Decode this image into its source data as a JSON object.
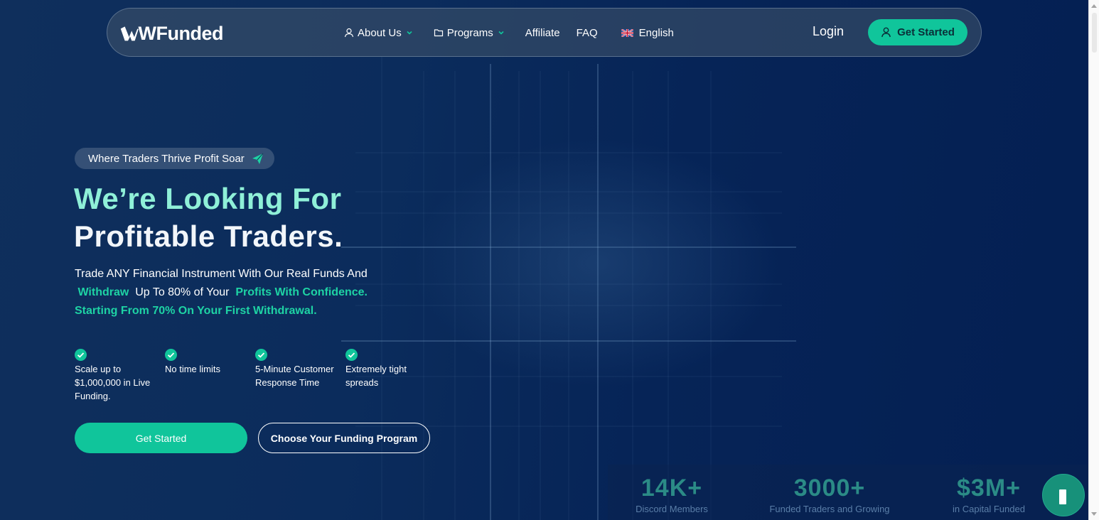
{
  "nav": {
    "brand": "WFunded",
    "items": [
      {
        "label": "About Us",
        "icon": "user-icon",
        "dropdown": true
      },
      {
        "label": "Programs",
        "icon": "folder-icon",
        "dropdown": true
      },
      {
        "label": "Affiliate"
      },
      {
        "label": "FAQ"
      },
      {
        "label": "English",
        "icon": "uk-flag-icon"
      }
    ],
    "login": "Login",
    "cta": "Get Started"
  },
  "hero": {
    "tagline": "Where Traders Thrive Profit Soar",
    "heading_line1": "We’re Looking For",
    "heading_line2": "Profitable Traders.",
    "sub_part1": "Trade ANY Financial Instrument With Our Real Funds And",
    "sub_highlight1": "Withdraw",
    "sub_part2": "Up To 80% of Your",
    "sub_highlight2": "Profits With Confidence.",
    "sub_line3": "Starting From 70% On Your First Withdrawal.",
    "features": [
      "Scale up to $1,000,000 in Live Funding.",
      "No time limits",
      "5-Minute Customer Response Time",
      "Extremely tight spreads"
    ],
    "primary_button": "Get Started",
    "secondary_button": "Choose Your Funding Program"
  },
  "stats": [
    {
      "value": "14K+",
      "label": "Discord  Members"
    },
    {
      "value": "3000+",
      "label": "Funded Traders and Growing"
    },
    {
      "value": "$3M+",
      "label": "in Capital Funded"
    }
  ],
  "colors": {
    "accent": "#10c59b",
    "heading_accent": "#8ff0d8",
    "background": "#0b2c5c"
  }
}
